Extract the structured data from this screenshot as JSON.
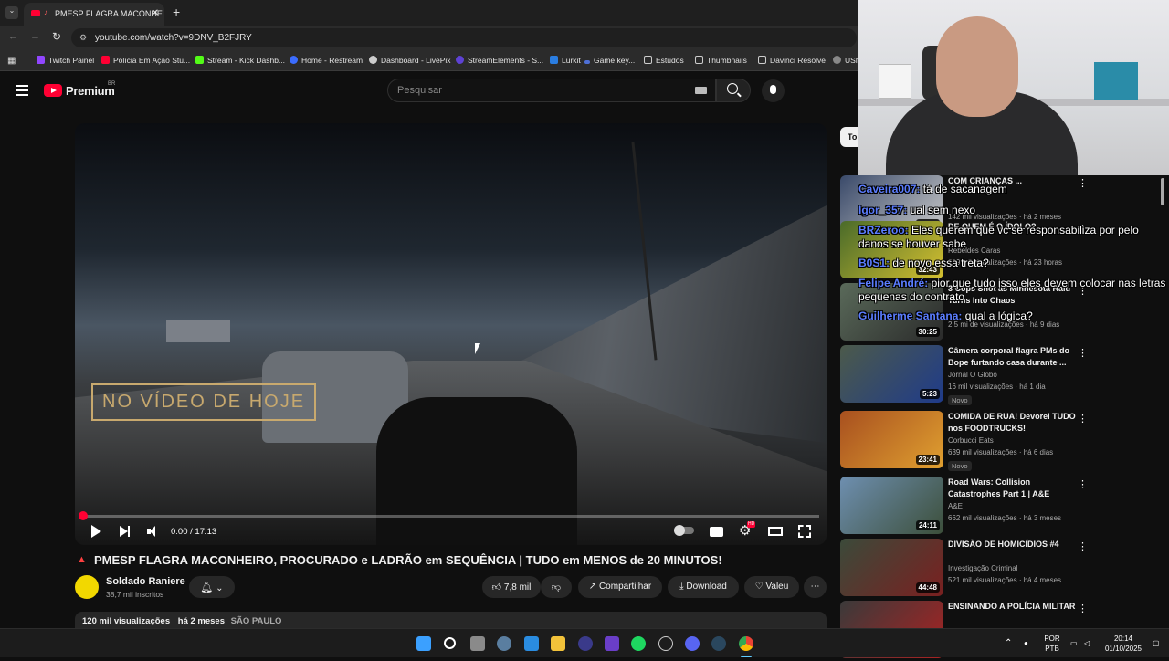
{
  "browser": {
    "tab_title": "PMESP FLAGRA MACONHE",
    "url": "youtube.com/watch?v=9DNV_B2FJRY",
    "bookmarks": [
      "Twitch Painel",
      "Polícia Em Ação Stu...",
      "Stream - Kick Dashb...",
      "Home - Restream",
      "Dashboard - LivePix",
      "StreamElements - S...",
      "Lurkit",
      "Game key...",
      "Estudos",
      "Thumbnails",
      "Davinci Resolve",
      "USN"
    ]
  },
  "youtube": {
    "logo": "Premium",
    "logo_region": "BR",
    "search_placeholder": "Pesquisar",
    "chip_label": "To"
  },
  "player": {
    "overlay_text": "NO VÍDEO DE HOJE",
    "time": "0:00 / 17:13",
    "progress": 0.0,
    "settings_badge": "HD"
  },
  "video": {
    "title": "PMESP FLAGRA MACONHEIRO, PROCURADO e LADRÃO em SEQUÊNCIA | TUDO em MENOS de 20 MINUTOS!",
    "channel": "Soldado Raniere",
    "subscribers": "38,7 mil inscritos",
    "likes": "7,8 mil",
    "share": "Compartilhar",
    "download": "Download",
    "thanks": "Valeu",
    "views": "120 mil visualizações",
    "date": "há 2 meses",
    "location": "SÃO PAULO"
  },
  "sidebar": [
    {
      "title": "COM CRIANÇAS ...",
      "channel": "",
      "meta": "142 mil visualizações · há 2 meses",
      "duration": "15:20",
      "badge": "",
      "colors": [
        "#3a4a6a",
        "#c8c8c8"
      ]
    },
    {
      "title": "DE QUEM É O ÍDOLO?",
      "channel": "Rebeldes Caras",
      "meta": "839 mil visualizações · há 23 horas",
      "duration": "32:43",
      "badge": "",
      "colors": [
        "#4a6b2a",
        "#d4c030"
      ]
    },
    {
      "title": "3 Cops Shot as Minnesota Raid Turns Into Chaos",
      "channel": "",
      "meta": "2,5 mi de visualizações · há 9 dias",
      "duration": "30:25",
      "badge": "",
      "colors": [
        "#5a6a5a",
        "#2a2a2a"
      ]
    },
    {
      "title": "Câmera corporal flagra PMs do Bope furtando casa durante ...",
      "channel": "Jornal O Globo",
      "meta": "16 mil visualizações · há 1 dia",
      "duration": "5:23",
      "badge": "Novo",
      "colors": [
        "#4c5a4a",
        "#1f3b8a"
      ]
    },
    {
      "title": "COMIDA DE RUA! Devorei TUDO nos FOODTRUCKS!",
      "channel": "Corbucci Eats",
      "meta": "639 mil visualizações · há 6 dias",
      "duration": "23:41",
      "badge": "Novo",
      "colors": [
        "#a8501f",
        "#e0a030"
      ]
    },
    {
      "title": "Road Wars: Collision Catastrophes Part 1 | A&E",
      "channel": "A&E",
      "meta": "662 mil visualizações · há 3 meses",
      "duration": "24:11",
      "badge": "",
      "colors": [
        "#6e8fb0",
        "#3c4f3a"
      ]
    },
    {
      "title": "DIVISÃO DE HOMICÍDIOS #4",
      "channel": "Investigação Criminal",
      "meta": "521 mil visualizações · há 4 meses",
      "duration": "44:48",
      "badge": "",
      "colors": [
        "#3b4a3a",
        "#7a2020"
      ]
    },
    {
      "title": "ENSINANDO A POLÍCIA MILITAR",
      "channel": "",
      "meta": "",
      "duration": "",
      "badge": "",
      "colors": [
        "#3a3a3a",
        "#aa2222"
      ]
    }
  ],
  "chat": [
    {
      "user": "Caveira007:",
      "text": "tá de sacanagem"
    },
    {
      "user": "Igor_357:",
      "text": "ual sem nexo"
    },
    {
      "user": "BRZeroo:",
      "text": "Eles querem que vc se responsabiliza por pelo danos se houver sabe"
    },
    {
      "user": "B0S1:",
      "text": "de novo essa treta?"
    },
    {
      "user": "Felipe André:",
      "text": "pior que tudo isso eles devem colocar nas letras pequenas do contrato"
    },
    {
      "user": "Guilherme Santana:",
      "text": "qual a lógica?"
    }
  ],
  "taskbar": {
    "lang": "POR",
    "layout": "PTB",
    "time": "20:14",
    "date": "01/10/2025"
  }
}
